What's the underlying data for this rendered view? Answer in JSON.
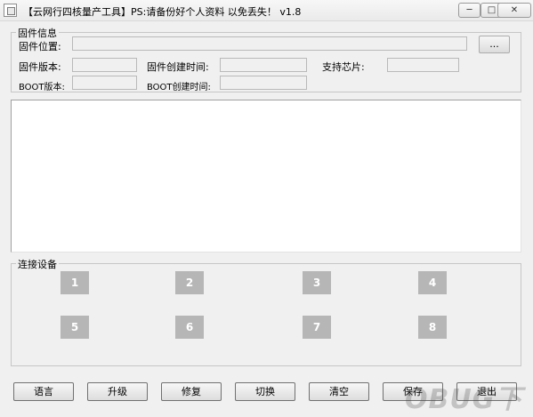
{
  "window": {
    "title": "【云网行四核量产工具】PS:请备份好个人资料 以免丢失！ v1.8",
    "minimize_glyph": "─",
    "maximize_glyph": "□",
    "close_glyph": "✕"
  },
  "firmware": {
    "legend": "固件信息",
    "location_label": "固件位置:",
    "location_value": "",
    "browse_label": "...",
    "version_label": "固件版本:",
    "version_value": "",
    "created_label": "固件创建时间:",
    "created_value": "",
    "chip_label": "支持芯片:",
    "chip_value": "",
    "boot_version_label": "BOOT版本:",
    "boot_version_value": "",
    "boot_created_label": "BOOT创建时间:",
    "boot_created_value": ""
  },
  "log": {
    "text": ""
  },
  "devices": {
    "legend": "连接设备",
    "slots": [
      "1",
      "2",
      "3",
      "4",
      "5",
      "6",
      "7",
      "8"
    ]
  },
  "buttons": {
    "language": "语言",
    "upgrade": "升级",
    "repair": "修复",
    "switch": "切换",
    "clear": "清空",
    "save": "保存",
    "exit": "退出"
  },
  "watermark": {
    "text": "OBUG下"
  },
  "icons": {
    "app": "app-window-icon"
  }
}
